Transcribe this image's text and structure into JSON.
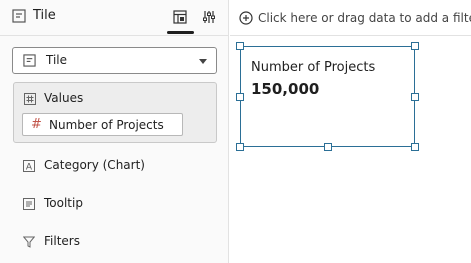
{
  "panel": {
    "title": "Tile",
    "viz_type": "Tile",
    "values_label": "Values",
    "measure_label": "Number of Projects",
    "category_label": "Category (Chart)",
    "tooltip_label": "Tooltip",
    "filters_label": "Filters"
  },
  "canvas": {
    "filter_prompt": "Click here or drag data to add a filter",
    "tile_title": "Number of Projects",
    "tile_value": "150,000"
  },
  "colors": {
    "selection_border": "#2b6f96",
    "measure_hash": "#c2554a",
    "values_bg": "#ededed"
  },
  "icons": [
    "tile-icon",
    "grammar-icon",
    "properties-icon",
    "hash-icon",
    "category-icon",
    "tooltip-icon",
    "filter-icon",
    "add-filter-icon"
  ]
}
